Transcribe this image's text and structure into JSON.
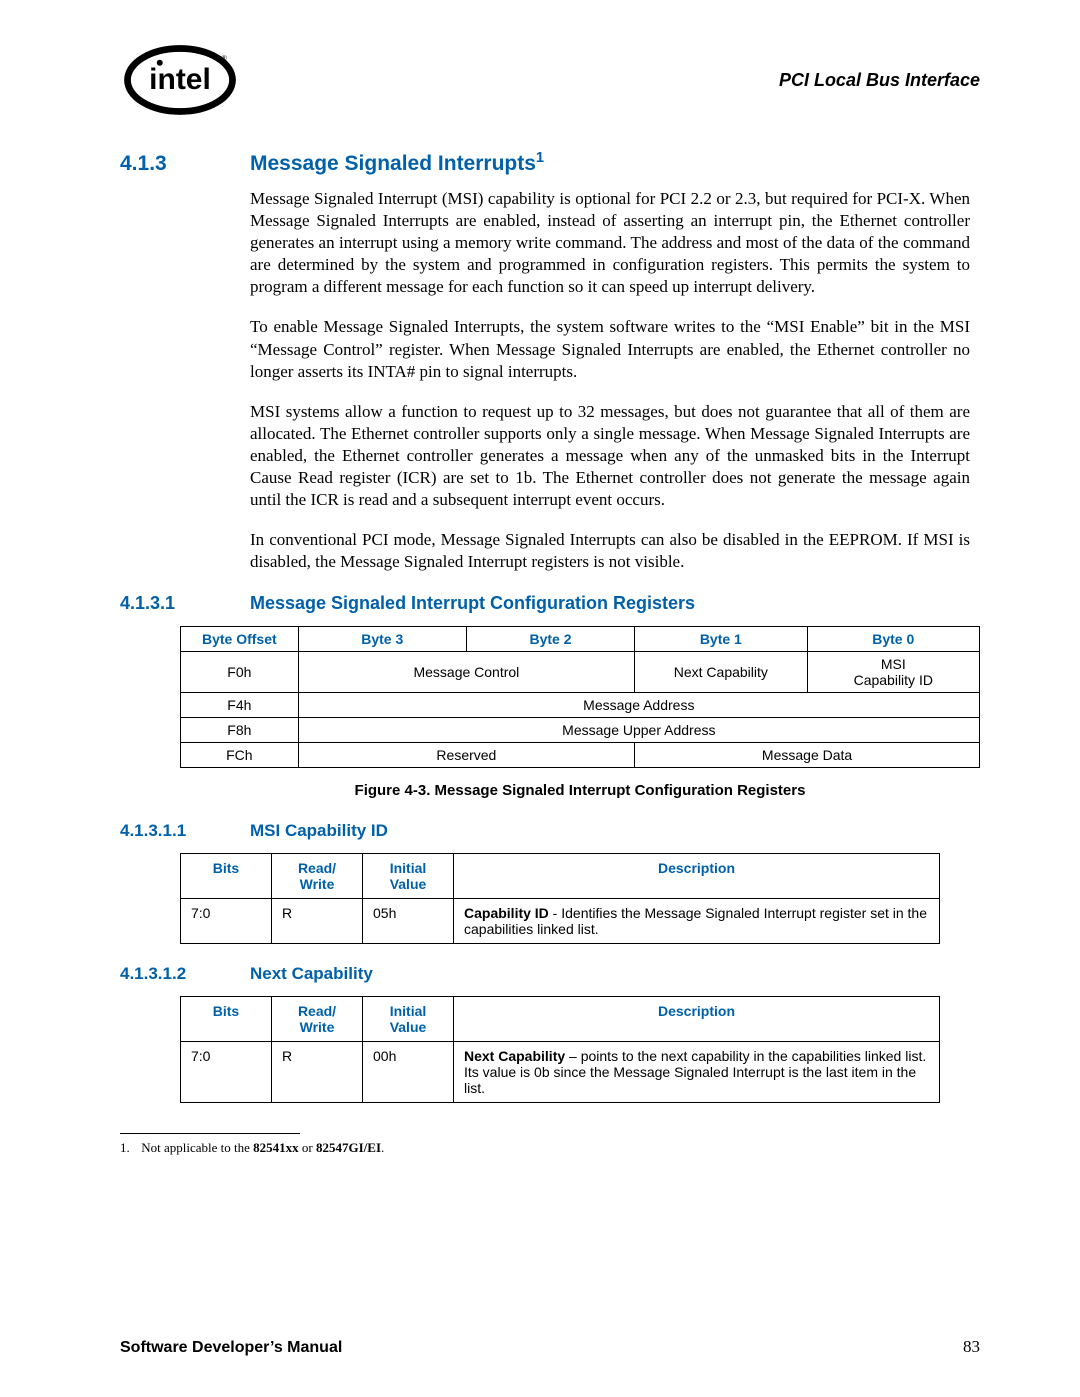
{
  "header": {
    "right_title": "PCI Local Bus Interface"
  },
  "sections": {
    "s413": {
      "num": "4.1.3",
      "title": "Message Signaled Interrupts",
      "sup": "1"
    },
    "s4131": {
      "num": "4.1.3.1",
      "title": "Message Signaled Interrupt Configuration Registers"
    },
    "s41311": {
      "num": "4.1.3.1.1",
      "title": "MSI Capability ID"
    },
    "s41312": {
      "num": "4.1.3.1.2",
      "title": "Next Capability"
    }
  },
  "paragraphs": {
    "p1": "Message Signaled Interrupt (MSI) capability is optional for PCI 2.2 or 2.3, but required for PCI-X. When Message Signaled Interrupts are enabled, instead of asserting an interrupt pin, the Ethernet controller generates an interrupt using a memory write command. The address and most of the data of the command are determined by the system and programmed in configuration registers. This permits the system to program a different message for each function so it can speed up interrupt delivery.",
    "p2": "To enable Message Signaled Interrupts, the system software writes to the “MSI Enable” bit in the MSI “Message Control” register. When Message Signaled Interrupts are enabled, the Ethernet controller no longer asserts its INTA# pin to signal interrupts.",
    "p3": "MSI systems allow a function to request up to 32 messages, but does not guarantee that all of them are allocated. The Ethernet controller supports only a single message. When Message Signaled Interrupts are enabled, the Ethernet controller generates a message when any of the unmasked bits in the Interrupt Cause Read register (ICR) are set to 1b. The Ethernet controller does not generate the message again until the ICR is read and a subsequent interrupt event occurs.",
    "p4": "In conventional PCI mode, Message Signaled Interrupts can also be disabled in the EEPROM. If MSI is disabled, the Message Signaled Interrupt registers is not visible."
  },
  "regLayout": {
    "headers": [
      "Byte Offset",
      "Byte 3",
      "Byte 2",
      "Byte 1",
      "Byte 0"
    ],
    "rows": {
      "r0": {
        "off": "F0h",
        "c32": "Message Control",
        "c1": "Next Capability",
        "c0a": "MSI",
        "c0b": "Capability ID"
      },
      "r1": {
        "off": "F4h",
        "c3210": "Message Address"
      },
      "r2": {
        "off": "F8h",
        "c3210": "Message Upper Address"
      },
      "r3": {
        "off": "FCh",
        "c32": "Reserved",
        "c10": "Message Data"
      }
    },
    "caption": "Figure 4-3. Message Signaled Interrupt Configuration Registers"
  },
  "bitHeaders": {
    "bits": "Bits",
    "rw": "Read/",
    "rw2": "Write",
    "iv": "Initial",
    "iv2": "Value",
    "desc": "Description"
  },
  "capId": {
    "bits": "7:0",
    "rw": "R",
    "iv": "05h",
    "desc_b": "Capability ID",
    "desc_t": " - Identifies the Message Signaled Interrupt register set in the capabilities linked list."
  },
  "nextCap": {
    "bits": "7:0",
    "rw": "R",
    "iv": "00h",
    "desc_b": "Next Capability",
    "desc_t": " – points to the next capability in the capabilities linked list. Its value is 0b since the Message Signaled Interrupt is the last item in the list."
  },
  "footnote": {
    "num": "1.",
    "text_a": "Not applicable to the ",
    "text_b1": "82541xx",
    "text_mid": " or ",
    "text_b2": "82547GI/EI",
    "text_end": "."
  },
  "footer": {
    "left": "Software Developer’s Manual",
    "page": "83"
  }
}
